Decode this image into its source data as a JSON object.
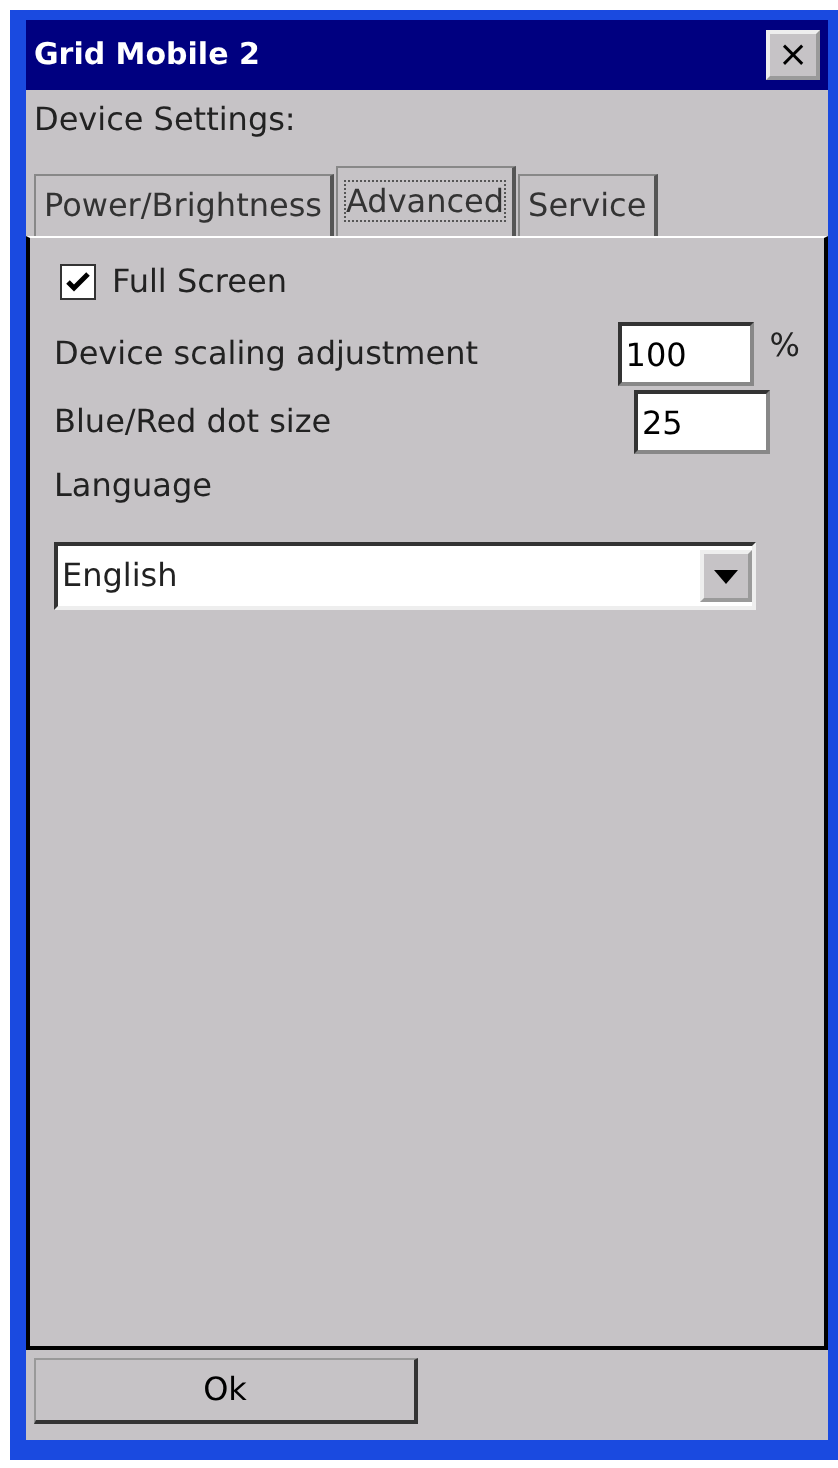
{
  "window": {
    "title": "Grid Mobile 2",
    "close": "×"
  },
  "heading": "Device Settings:",
  "tabs": [
    {
      "label": "Power/Brightness",
      "selected": false
    },
    {
      "label": "Advanced",
      "selected": true
    },
    {
      "label": "Service",
      "selected": false
    }
  ],
  "full_screen": {
    "label": "Full Screen",
    "checked": true
  },
  "fields": [
    {
      "label": "Device scaling adjustment",
      "value": "100",
      "unit": "%"
    },
    {
      "label": "Blue/Red dot size",
      "value": "25"
    }
  ],
  "language": {
    "label": "Language",
    "value": "English"
  },
  "buttons": [
    "Ok"
  ]
}
